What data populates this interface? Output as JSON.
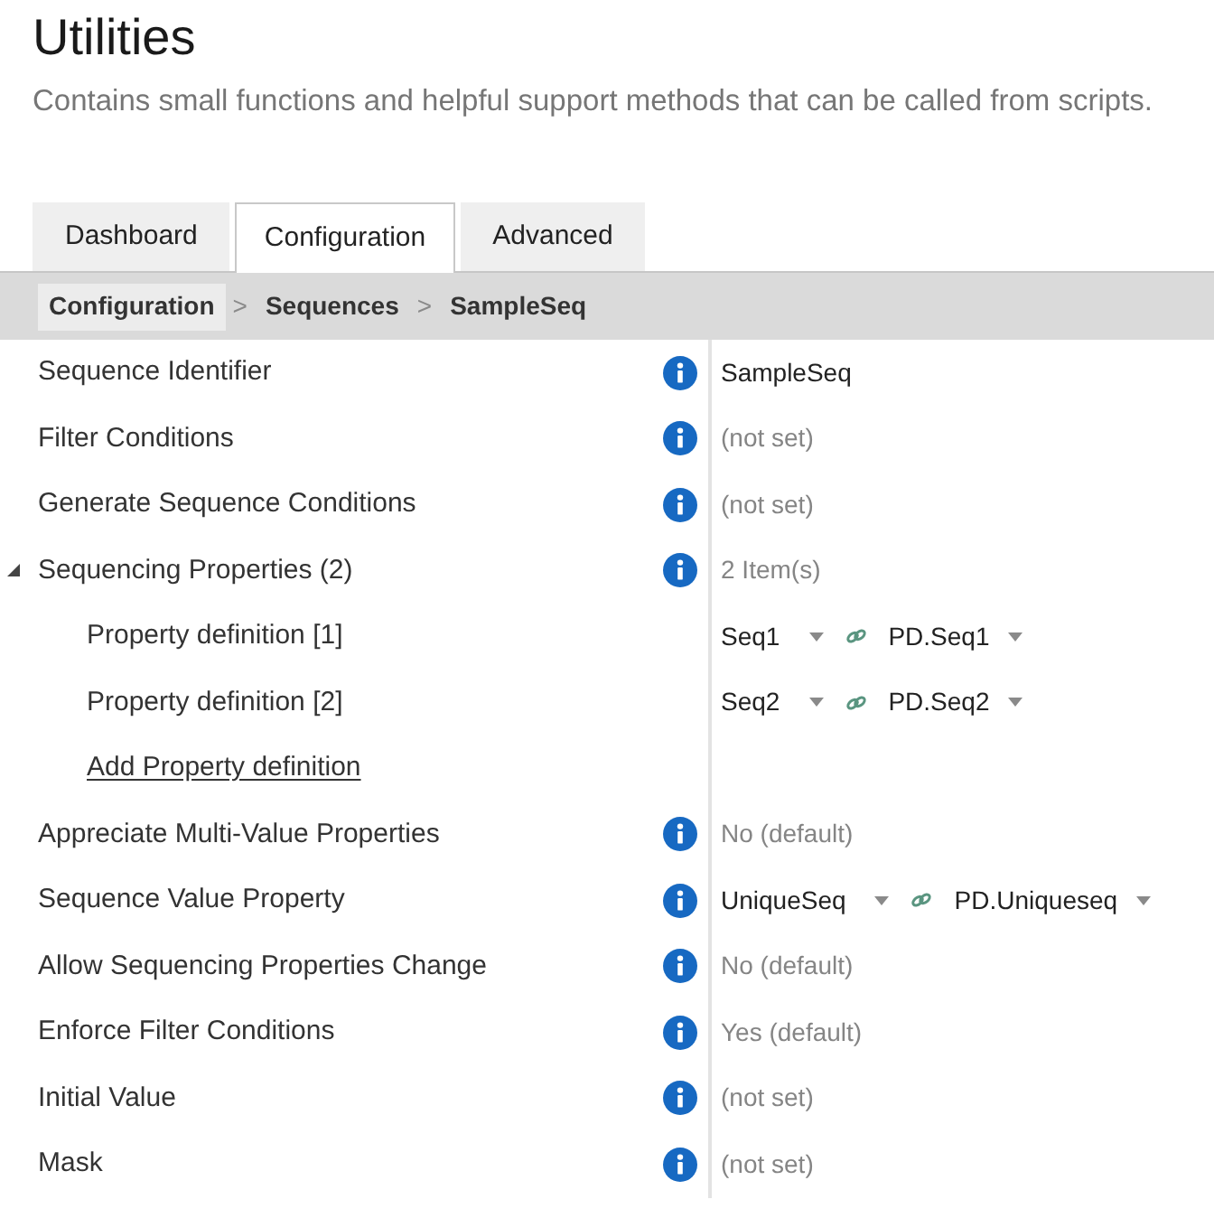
{
  "header": {
    "title": "Utilities",
    "description": "Contains small functions and helpful support methods that can be called from scripts."
  },
  "tabs": [
    {
      "label": "Dashboard",
      "selected": false
    },
    {
      "label": "Configuration",
      "selected": true
    },
    {
      "label": "Advanced",
      "selected": false
    }
  ],
  "breadcrumb": [
    {
      "label": "Configuration",
      "highlighted": true
    },
    {
      "separator": ">",
      "label": "Sequences",
      "highlighted": false
    },
    {
      "separator": ">",
      "label": "SampleSeq",
      "highlighted": false
    }
  ],
  "rows": [
    {
      "kind": "property",
      "label": "Sequence Identifier",
      "value": "SampleSeq",
      "muted": false
    },
    {
      "kind": "property",
      "label": "Filter Conditions",
      "value": "(not set)",
      "muted": true
    },
    {
      "kind": "property",
      "label": "Generate Sequence Conditions",
      "value": "(not set)",
      "muted": true
    },
    {
      "kind": "group",
      "label": "Sequencing Properties (2)",
      "value": "2 Item(s)",
      "muted": true,
      "expanded": true,
      "children": [
        {
          "kind": "mapping",
          "label": "Property definition [1]",
          "source": "Seq1",
          "target": "PD.Seq1"
        },
        {
          "kind": "mapping",
          "label": "Property definition [2]",
          "source": "Seq2",
          "target": "PD.Seq2"
        },
        {
          "kind": "link",
          "label": "Add Property definition"
        }
      ]
    },
    {
      "kind": "property",
      "label": "Appreciate Multi-Value Properties",
      "value": "No (default)",
      "muted": true
    },
    {
      "kind": "mapping",
      "label": "Sequence Value Property",
      "source": "UniqueSeq",
      "target": "PD.Uniqueseq"
    },
    {
      "kind": "property",
      "label": "Allow Sequencing Properties Change",
      "value": "No (default)",
      "muted": true
    },
    {
      "kind": "property",
      "label": "Enforce Filter Conditions",
      "value": "Yes (default)",
      "muted": true
    },
    {
      "kind": "property",
      "label": "Initial Value",
      "value": "(not set)",
      "muted": true
    },
    {
      "kind": "property",
      "label": "Mask",
      "value": "(not set)",
      "muted": true
    }
  ]
}
